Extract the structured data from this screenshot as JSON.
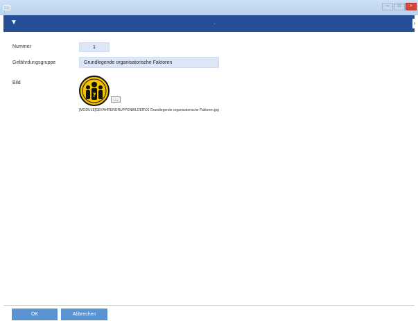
{
  "window": {
    "min_label": "─",
    "max_label": "□",
    "close_label": "×"
  },
  "ribbon": {
    "edge_label": "›",
    "dot": "·"
  },
  "form": {
    "nummer_label": "Nummer",
    "nummer_value": "1",
    "gruppe_label": "Gefährdungsgruppe",
    "gruppe_value": "Grundlegende organisatorische Faktoren",
    "bild_label": "Bild",
    "browse_label": "...",
    "bild_path": "[MODULE]GEFAHRENGRUPPENBILDER\\01 Grundlegende organisatorische Faktoren.jpg"
  },
  "buttons": {
    "ok": "OK",
    "cancel": "Abbrechen"
  },
  "colors": {
    "ribbon": "#254f97",
    "field": "#dbe6f7",
    "button": "#5a93d4",
    "logo_yellow": "#f2c400"
  }
}
